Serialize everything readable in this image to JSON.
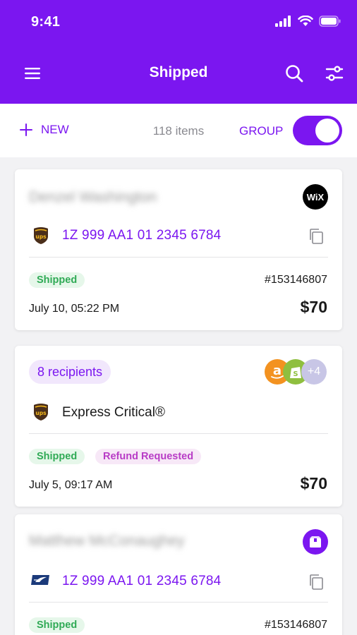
{
  "status_bar": {
    "time": "9:41"
  },
  "header": {
    "title": "Shipped"
  },
  "toolbar": {
    "new_label": "NEW",
    "items_count": "118 items",
    "group_label": "GROUP",
    "group_enabled": true
  },
  "cards": [
    {
      "recipient": "Denzel Washington",
      "store_badge": "WiX",
      "carrier": "ups",
      "tracking": "1Z 999 AA1 01 2345 6784",
      "status": "Shipped",
      "order_number": "#153146807",
      "date": "July 10, 05:22 PM",
      "price": "$70"
    },
    {
      "recipients": "8 recipients",
      "store_badges": [
        "amazon",
        "shopify"
      ],
      "more_stores": "+4",
      "carrier": "ups",
      "service": "Express Critical®",
      "status": "Shipped",
      "extra_status": "Refund Requested",
      "date": "July 5, 09:17 AM",
      "price": "$70"
    },
    {
      "recipient": "Matthew McConaughey",
      "store_badge": "box",
      "carrier": "usps",
      "tracking": "1Z 999 AA1 01 2345 6784",
      "status": "Shipped",
      "order_number": "#153146807"
    }
  ],
  "colors": {
    "brand": "#7b16f0",
    "shipped_bg": "#e6f7ea",
    "shipped_text": "#2faa55",
    "refund_bg": "#f7e8f7",
    "refund_text": "#b83cc6"
  }
}
